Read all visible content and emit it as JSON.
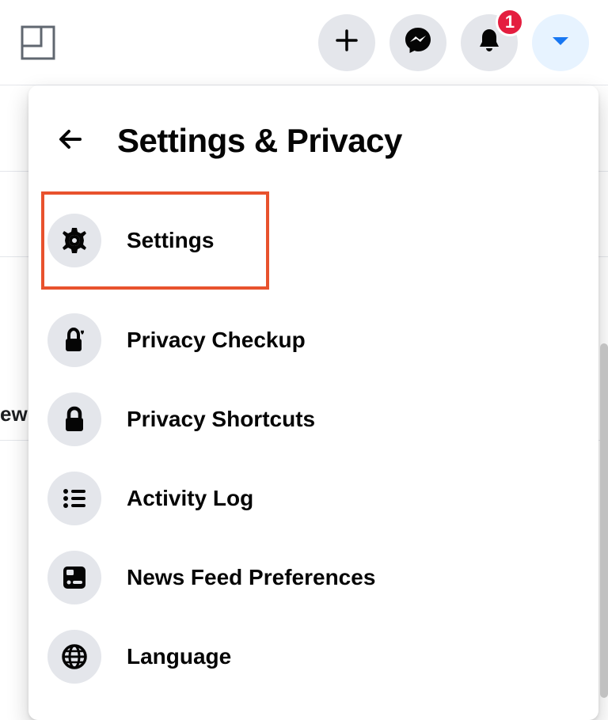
{
  "header": {
    "notifications_badge": "1"
  },
  "background": {
    "partial_text": "ew"
  },
  "panel": {
    "title": "Settings & Privacy",
    "items": [
      {
        "label": "Settings",
        "icon": "gear-icon",
        "highlighted": true
      },
      {
        "label": "Privacy Checkup",
        "icon": "lock-heart-icon",
        "highlighted": false
      },
      {
        "label": "Privacy Shortcuts",
        "icon": "lock-icon",
        "highlighted": false
      },
      {
        "label": "Activity Log",
        "icon": "list-icon",
        "highlighted": false
      },
      {
        "label": "News Feed Preferences",
        "icon": "feed-icon",
        "highlighted": false
      },
      {
        "label": "Language",
        "icon": "globe-icon",
        "highlighted": false
      }
    ]
  }
}
